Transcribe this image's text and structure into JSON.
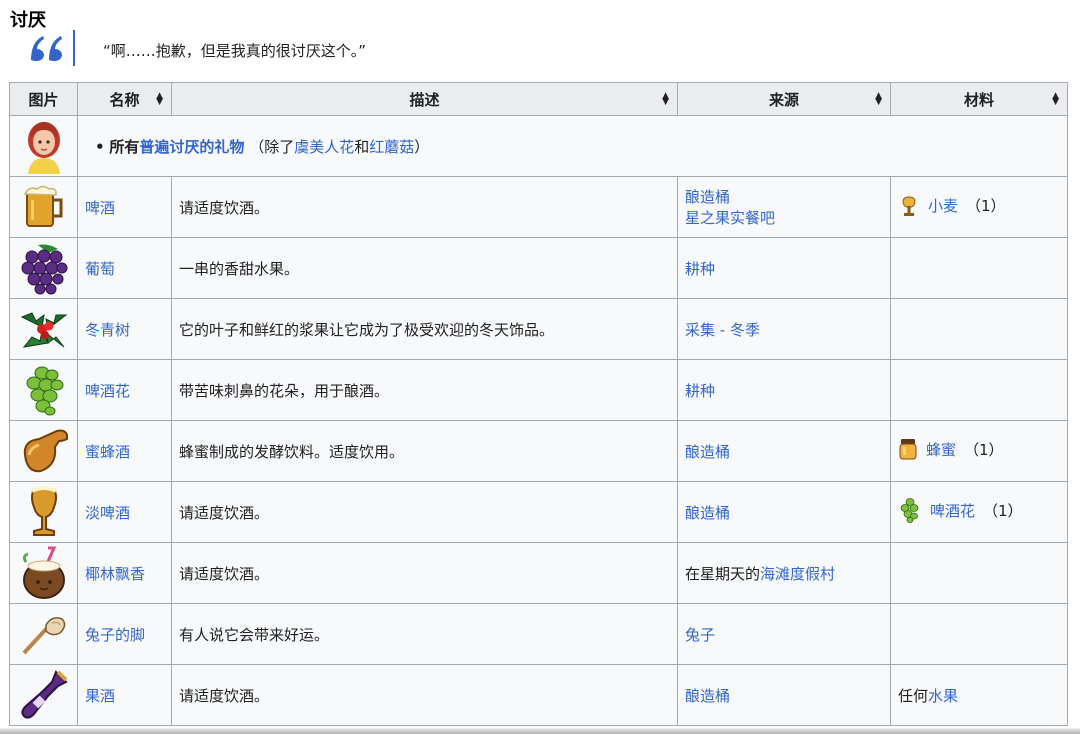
{
  "section": {
    "title": "讨厌"
  },
  "quote": {
    "text": "“啊……抱歉，但是我真的很讨厌这个。”"
  },
  "table": {
    "headers": {
      "image": "图片",
      "name": "名称",
      "description": "描述",
      "source": "来源",
      "materials": "材料"
    },
    "villager_row": {
      "bullet": "•",
      "prefix": "所有",
      "link": "普遍讨厌的礼物",
      "paren_open": "（除了",
      "exception1": "虞美人花",
      "and": "和",
      "exception2": "红蘑菇",
      "paren_close": "）"
    },
    "rows": [
      {
        "icon": "beer-icon",
        "name": "啤酒",
        "description": "请适度饮酒。",
        "source": [
          "酿造桶",
          "星之果实餐吧"
        ],
        "material": {
          "icon": "wheat-icon",
          "name": "小麦",
          "qty": "（1）"
        }
      },
      {
        "icon": "grape-icon",
        "name": "葡萄",
        "description": "一串的香甜水果。",
        "source": [
          "耕种"
        ],
        "material": null
      },
      {
        "icon": "holly-icon",
        "name": "冬青树",
        "description": "它的叶子和鲜红的浆果让它成为了极受欢迎的冬天饰品。",
        "source": [
          "采集 - 冬季"
        ],
        "material": null
      },
      {
        "icon": "hops-icon",
        "name": "啤酒花",
        "description": "带苦味刺鼻的花朵，用于酿酒。",
        "source": [
          "耕种"
        ],
        "material": null
      },
      {
        "icon": "mead-icon",
        "name": "蜜蜂酒",
        "description": "蜂蜜制成的发酵饮料。适度饮用。",
        "source": [
          "酿造桶"
        ],
        "material": {
          "icon": "honey-icon",
          "name": "蜂蜜",
          "qty": "（1）"
        }
      },
      {
        "icon": "pale-ale-icon",
        "name": "淡啤酒",
        "description": "请适度饮酒。",
        "source": [
          "酿造桶"
        ],
        "material": {
          "icon": "hops-small-icon",
          "name": "啤酒花",
          "qty": "（1）"
        }
      },
      {
        "icon": "pina-colada-icon",
        "name": "椰林飘香",
        "description": "请适度饮酒。",
        "source_prefix": "在星期天的",
        "source": [
          "海滩度假村"
        ],
        "material": null
      },
      {
        "icon": "rabbit-foot-icon",
        "name": "兔子的脚",
        "description": "有人说它会带来好运。",
        "source": [
          "兔子"
        ],
        "material": null
      },
      {
        "icon": "wine-icon",
        "name": "果酒",
        "description": "请适度饮酒。",
        "source": [
          "酿造桶"
        ],
        "material_text": {
          "prefix": "任何",
          "link": "水果"
        }
      }
    ]
  }
}
